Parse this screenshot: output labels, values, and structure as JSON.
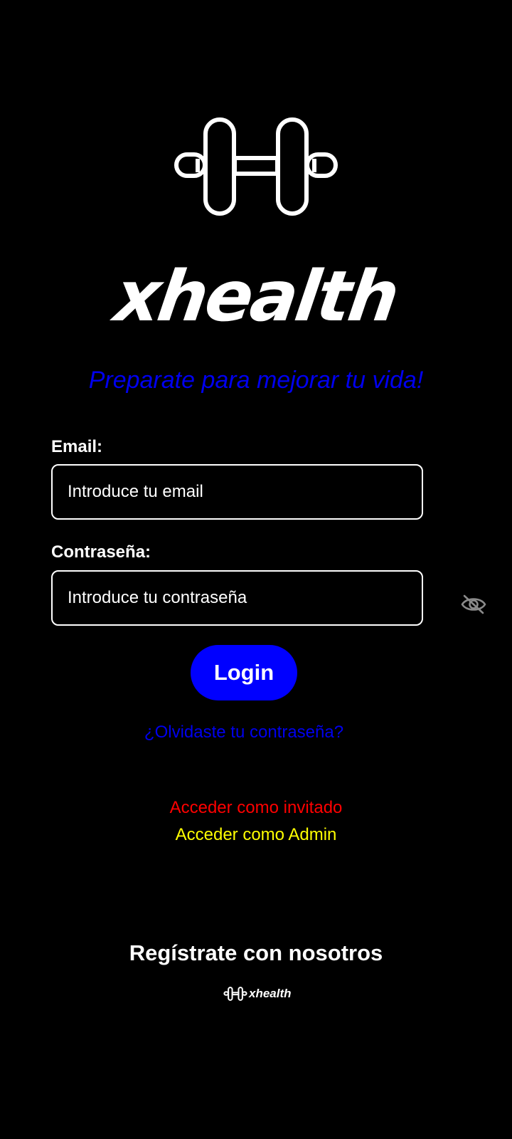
{
  "app": {
    "brand_name": "xhealth",
    "tagline": "Preparate para mejorar tu vida!",
    "logo_icon": "dumbbell-icon"
  },
  "login_form": {
    "email_label": "Email:",
    "email_placeholder": "Introduce tu email",
    "email_value": "",
    "password_label": "Contraseña:",
    "password_placeholder": "Introduce tu contraseña",
    "password_value": "",
    "password_toggle_icon": "eye-off-icon",
    "login_label": "Login",
    "forgot_password_label": "¿Olvidaste tu contraseña?"
  },
  "alt_access": {
    "guest_label": "Acceder como invitado",
    "admin_label": "Acceder como Admin"
  },
  "footer": {
    "register_label": "Regístrate con nosotros",
    "brand_name": "xhealth"
  },
  "colors": {
    "background": "#000000",
    "primary_blue": "#0000ff",
    "link_blue": "#0000ee",
    "guest_red": "#ff0000",
    "admin_yellow": "#ffff00"
  }
}
